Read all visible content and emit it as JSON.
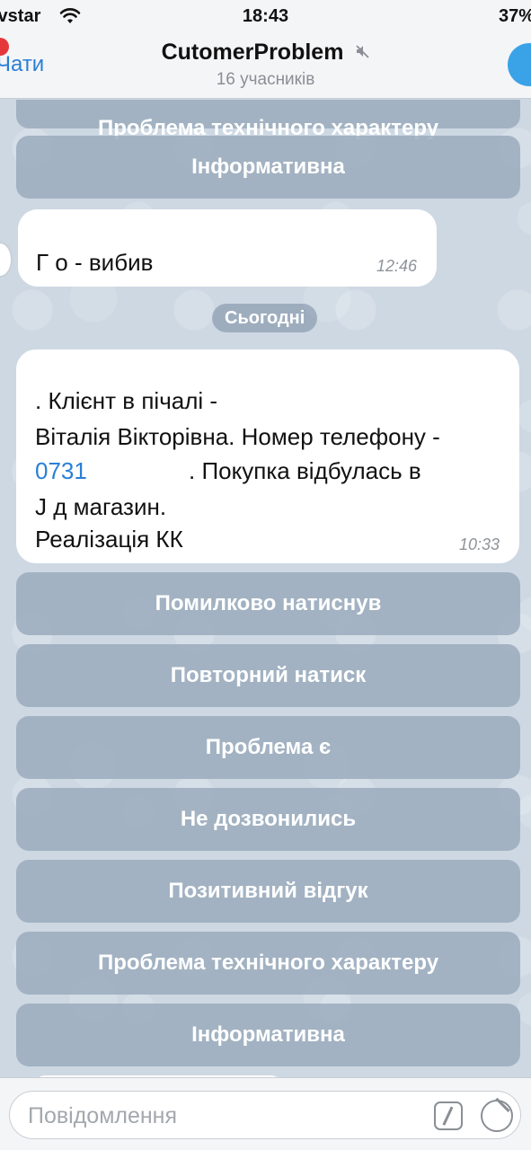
{
  "status_bar": {
    "carrier": "ivstar",
    "time": "18:43",
    "battery": "37%"
  },
  "header": {
    "back_label": "Чати",
    "title": "CutomerProblem",
    "subtitle": "16 учасників"
  },
  "chat": {
    "top_buttons": [
      {
        "label": "Проблема технічного характеру"
      },
      {
        "label": "Інформативна"
      }
    ],
    "earlier_message": {
      "text": "Г                          о - вибив",
      "time": "12:46"
    },
    "date_separator": "Сьогодні",
    "message": {
      "lines": [
        "       . Клієнт в пічалі -",
        "Віталія Вікторівна. Номер телефону -",
        ". Покупка відбулась в",
        "J                                   д магазин.",
        "Реалізація КК"
      ],
      "phone": "0731",
      "time": "10:33"
    },
    "keyboard": [
      {
        "label": "Помилково натиснув"
      },
      {
        "label": "Повторний натиск"
      },
      {
        "label": "Проблема є"
      },
      {
        "label": "Не дозвонились"
      },
      {
        "label": "Позитивний відгук"
      },
      {
        "label": "Проблема технічного характеру"
      },
      {
        "label": "Інформативна"
      }
    ]
  },
  "input": {
    "placeholder": "Повідомлення"
  },
  "icons": {
    "wifi": "wifi-icon",
    "mute": "mute-icon",
    "commands": "bot-commands-icon",
    "sticker": "sticker-icon"
  },
  "colors": {
    "accent": "#2a7fd4",
    "badge": "#e5373a",
    "keyboard_button": "#96a6b8"
  }
}
